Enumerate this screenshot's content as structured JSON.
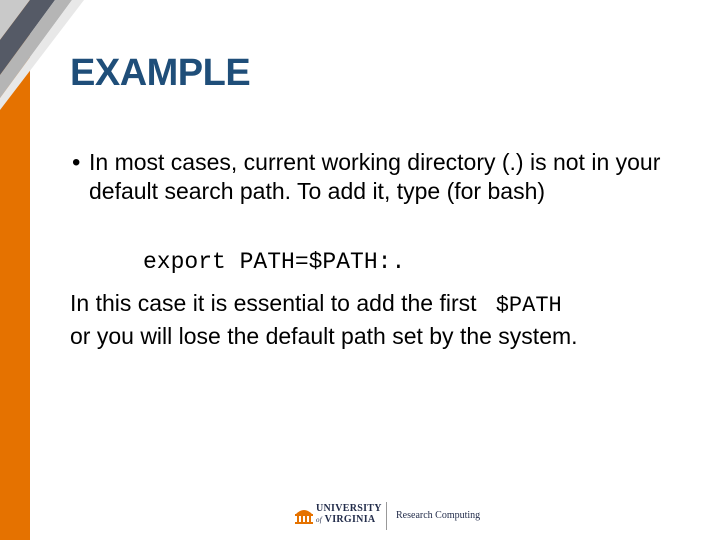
{
  "slide": {
    "title": "EXAMPLE",
    "bullet": "In most cases, current working directory (.) is not in your default search path.  To add it, type (for bash)",
    "code": "export PATH=$PATH:.",
    "paragraph_before": "In this case it is essential to add the first",
    "paragraph_code": "$PATH",
    "paragraph_after": "or you will lose the default path set by the system."
  },
  "footer": {
    "logo_line1": "UNIVERSITY",
    "logo_line2": "VIRGINIA",
    "logo_of": "of",
    "department": "Research Computing"
  },
  "colors": {
    "accent_orange": "#e57200",
    "title_blue": "#1f4e79",
    "navy": "#232d4b"
  }
}
